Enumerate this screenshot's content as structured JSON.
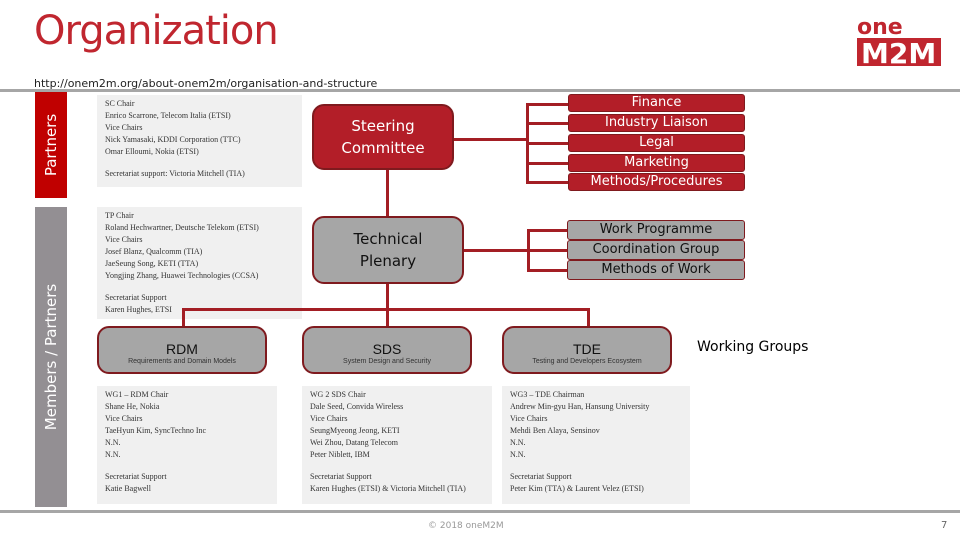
{
  "header": {
    "title": "Organization",
    "url": "http://onem2m.org/about-onem2m/organisation-and-structure",
    "logo": {
      "top": "one",
      "bottom": "M2M",
      "icon": "onem2m-logo"
    }
  },
  "side_labels": {
    "partners": "Partners",
    "members_partners": "Members / Partners"
  },
  "steering_committee": {
    "label_line1": "Steering",
    "label_line2": "Committee",
    "info": [
      "SC Chair",
      "Enrico Scarrone, Telecom Italia (ETSI)",
      "Vice Chairs",
      "Nick Yamasaki, KDDI Corporation (TTC)",
      "Omar Elloumi, Nokia (ETSI)",
      "",
      "Secretariat support: Victoria Mitchell (TIA)"
    ],
    "sub_groups": [
      "Finance",
      "Industry Liaison",
      "Legal",
      "Marketing",
      "Methods/Procedures"
    ]
  },
  "technical_plenary": {
    "label_line1": "Technical",
    "label_line2": "Plenary",
    "info": [
      "TP Chair",
      "Roland Hechwartner, Deutsche Telekom (ETSI)",
      "Vice Chairs",
      "Josef Blanz, Qualcomm (TIA)",
      "JaeSeung Song, KETI (TTA)",
      "Yongjing Zhang, Huawei Technologies (CCSA)",
      "",
      "Secretariat Support",
      "Karen Hughes, ETSI"
    ],
    "sub_groups": [
      "Work Programme",
      "Coordination Group",
      "Methods of Work"
    ]
  },
  "working_groups": {
    "title": "Working Groups",
    "groups": [
      {
        "name": "RDM",
        "subtitle": "Requirements and Domain Models",
        "info": [
          "WG1 – RDM Chair",
          "Shane He, Nokia",
          "Vice Chairs",
          "TaeHyun Kim, SyncTechno Inc",
          "N.N.",
          "N.N.",
          "",
          "Secretariat Support",
          "Katie Bagwell"
        ]
      },
      {
        "name": "SDS",
        "subtitle": "System Design and Security",
        "info": [
          "WG 2 SDS Chair",
          "Dale Seed, Convida Wireless",
          "Vice Chairs",
          "SeungMyeong Jeong, KETI",
          "Wei Zhou, Datang Telecom",
          "Peter Niblett, IBM",
          "",
          "Secretariat Support",
          "Karen Hughes (ETSI) & Victoria Mitchell (TIA)"
        ]
      },
      {
        "name": "TDE",
        "subtitle": "Testing and Developers Ecosystem",
        "info": [
          "WG3 – TDE Chairman",
          "Andrew Min-gyu Han, Hansung University",
          "Vice Chairs",
          "Mehdi Ben Alaya, Sensinov",
          "N.N.",
          "N.N.",
          "",
          "Secretariat Support",
          "Peter Kim (TTA) & Laurent Velez (ETSI)"
        ]
      }
    ]
  },
  "footer": {
    "copyright": "© 2018 oneM2M",
    "page_number": "7"
  },
  "colors": {
    "brand_red": "#c0262f",
    "box_red": "#b31e28",
    "box_grey": "#a6a6a6",
    "panel_bg": "#f0f0f0",
    "members_grey": "#938f93"
  }
}
